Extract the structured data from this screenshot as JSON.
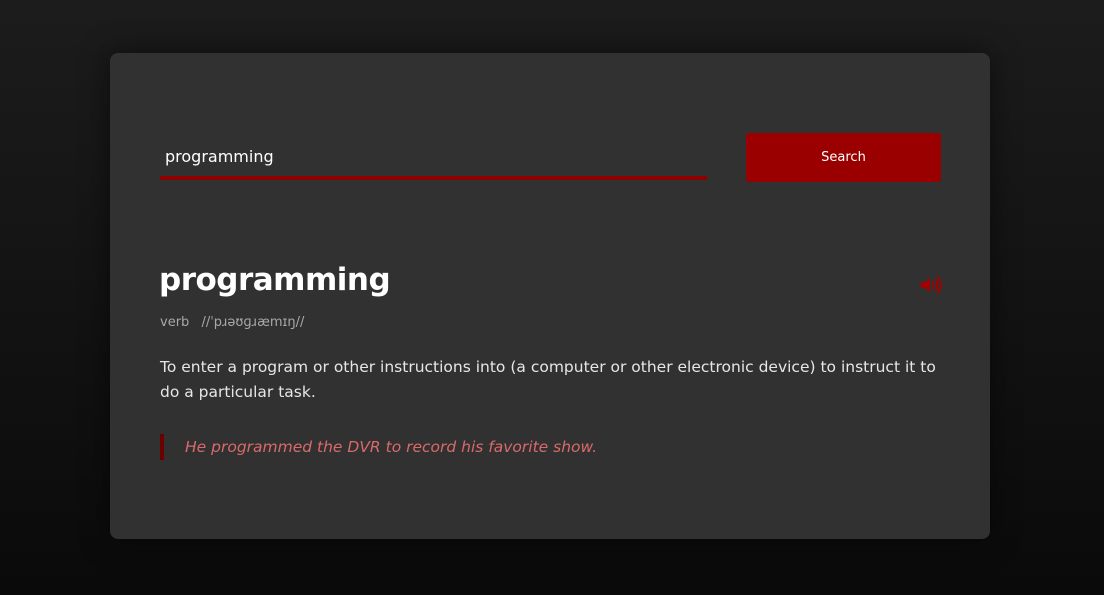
{
  "search": {
    "value": "programming",
    "button_label": "Search"
  },
  "result": {
    "word": "programming",
    "part_of_speech": "verb",
    "phonetic": "//ˈpɹəʊɡɹæmɪŋ//",
    "definition": "To enter a program or other instructions into (a computer or other electronic device) to instruct it to do a particular task.",
    "example": "He programmed the DVR to record his favorite show."
  },
  "icons": {
    "pronounce": "speaker-icon"
  },
  "colors": {
    "accent": "#9a0000",
    "card": "#313131",
    "example_text": "#d96a6a"
  }
}
